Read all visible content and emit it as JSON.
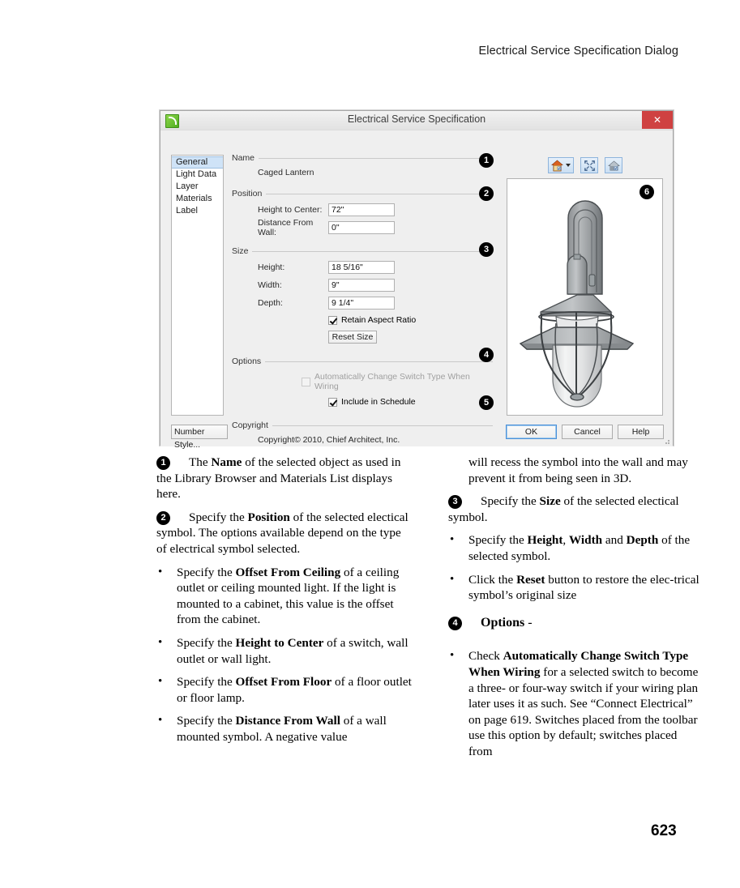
{
  "page": {
    "header_title": "Electrical Service Specification Dialog",
    "page_number": "623"
  },
  "dialog": {
    "title": "Electrical Service Specification",
    "app_icon": "chief-architect-icon",
    "close_label": "✕",
    "categories": [
      {
        "label": "General",
        "selected": true
      },
      {
        "label": "Light Data",
        "selected": false
      },
      {
        "label": "Layer",
        "selected": false
      },
      {
        "label": "Materials",
        "selected": false
      },
      {
        "label": "Label",
        "selected": false
      }
    ],
    "groups": {
      "name": {
        "heading": "Name",
        "value": "Caged Lantern",
        "callout": "1"
      },
      "position": {
        "heading": "Position",
        "callout": "2",
        "fields": [
          {
            "label": "Height to Center:",
            "value": "72\""
          },
          {
            "label": "Distance From Wall:",
            "value": "0\""
          }
        ]
      },
      "size": {
        "heading": "Size",
        "callout": "3",
        "fields": [
          {
            "label": "Height:",
            "value": "18 5/16\""
          },
          {
            "label": "Width:",
            "value": "9\""
          },
          {
            "label": "Depth:",
            "value": "9 1/4\""
          }
        ],
        "retain_aspect_ratio": {
          "label": "Retain Aspect Ratio",
          "checked": true
        },
        "reset_button": "Reset Size"
      },
      "options": {
        "heading": "Options",
        "callout": "4",
        "checkboxes": [
          {
            "label": "Automatically Change Switch Type When Wiring",
            "checked": false,
            "disabled": true
          },
          {
            "label": "Include in Schedule",
            "checked": true,
            "disabled": false
          }
        ]
      },
      "copyright": {
        "heading": "Copyright",
        "callout": "5",
        "text": "Copyright© 2010, Chief Architect, Inc."
      }
    },
    "preview": {
      "callout": "6",
      "toolbar": [
        {
          "name": "rendering-mode",
          "icon": "house-icon",
          "has_caret": true
        },
        {
          "name": "fill-window",
          "icon": "fit-to-window-icon",
          "has_caret": false
        },
        {
          "name": "view-options",
          "icon": "house-options-icon",
          "has_caret": false
        }
      ]
    },
    "footer": {
      "number_style": "Number Style...",
      "ok": "OK",
      "cancel": "Cancel",
      "help": "Help"
    }
  },
  "body": {
    "left_column": [
      {
        "kind": "numbered",
        "number": "1",
        "html": "The <b>Name</b> of the selected object as used in the Library Browser and Materials List displays here."
      },
      {
        "kind": "numbered",
        "number": "2",
        "html": "Specify the <b>Position</b> of the selected electical symbol. The options available depend on the type of electrical symbol selected."
      },
      {
        "kind": "bullet",
        "html": "Specify the <b>Offset From Ceiling</b> of a ceiling outlet or ceiling mounted light. If the light is mounted to a cabinet, this value is the offset from the cabinet."
      },
      {
        "kind": "bullet",
        "html": "Specify the <b>Height to Center</b> of a switch, wall outlet or wall light."
      },
      {
        "kind": "bullet",
        "html": "Specify the <b>Offset From Floor</b> of a floor outlet or floor lamp."
      },
      {
        "kind": "bullet",
        "html": "Specify the <b>Distance From Wall</b> of a wall mounted symbol. A negative value"
      }
    ],
    "right_column": [
      {
        "kind": "continuation",
        "html": "will recess the symbol into the wall and may prevent it from being seen in 3D."
      },
      {
        "kind": "numbered",
        "number": "3",
        "html": "Specify the <b>Size</b> of the selected electical symbol."
      },
      {
        "kind": "bullet",
        "html": "Specify the <b>Height</b>, <b>Width</b> and <b>Depth</b> of the selected symbol."
      },
      {
        "kind": "bullet",
        "html": "Click the <b>Reset</b> button to restore the elec-trical symbol’s original size"
      },
      {
        "kind": "numbered",
        "number": "4",
        "html": "<b>Options</b> -"
      },
      {
        "kind": "bullet",
        "html": "Check <b>Automatically Change Switch Type When Wiring</b> for a selected switch to become a three- or four-way switch if your wiring plan later uses it as such. See “Connect Electrical” on page 619. Switches placed from the toolbar use this option by default; switches placed from"
      }
    ]
  },
  "colors": {
    "dialog_bg": "#efefef",
    "selection_blue": "#cfe3f7",
    "close_red": "#cf4141",
    "accent_blue": "#4a90d9"
  }
}
